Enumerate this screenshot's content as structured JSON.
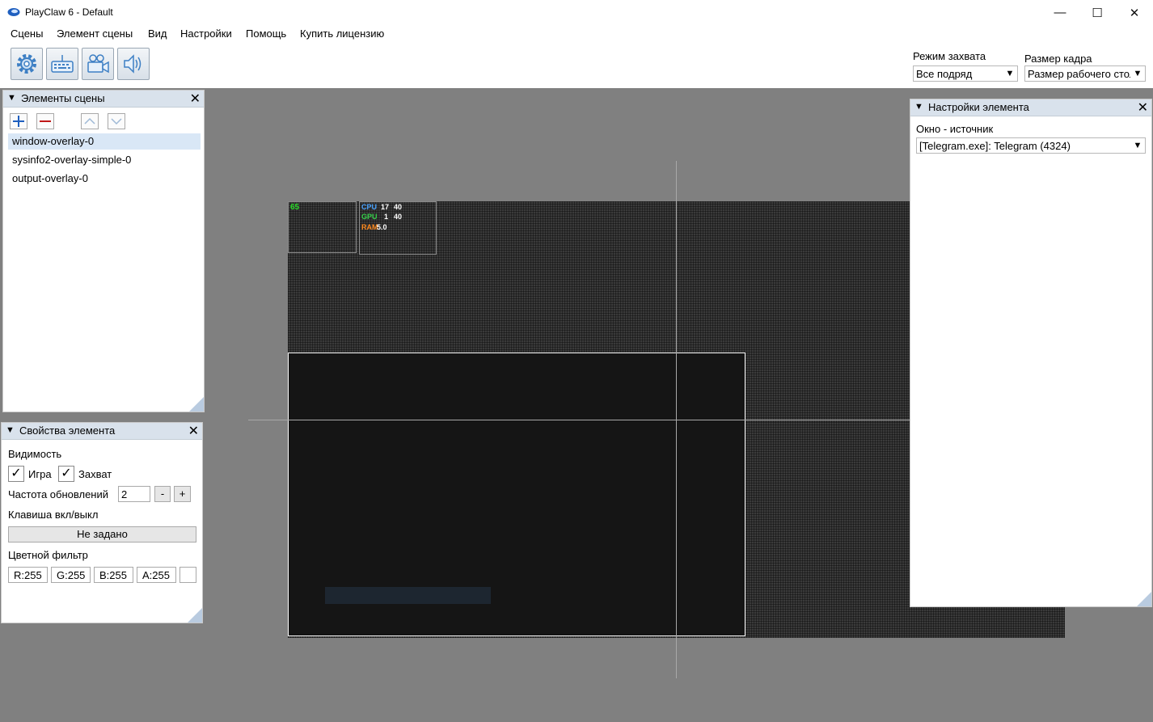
{
  "window": {
    "title": "PlayClaw 6 - Default",
    "controls": {
      "minimize": "—",
      "maximize": "☐",
      "close": "✕"
    }
  },
  "menu": [
    "Сцены",
    "Элемент сцены",
    "Вид",
    "Настройки",
    "Помощь",
    "Купить лицензию"
  ],
  "toolbar": {
    "icons": [
      "gear-icon",
      "keyboard-icon",
      "camera-icon",
      "speaker-icon"
    ],
    "capture_mode": {
      "label": "Режим захвата",
      "value": "Все подряд"
    },
    "frame_size": {
      "label": "Размер кадра",
      "value": "Размер рабочего стола"
    }
  },
  "scene_panel": {
    "title": "Элементы сцены",
    "items": [
      "window-overlay-0",
      "sysinfo2-overlay-simple-0",
      "output-overlay-0"
    ],
    "selected_index": 0
  },
  "props_panel": {
    "title": "Свойства элемента",
    "visibility_label": "Видимость",
    "game_label": "Игра",
    "capture_label": "Захват",
    "game_checked": true,
    "capture_checked": true,
    "refresh_label": "Частота обновлений",
    "refresh_value": "2",
    "minus": "-",
    "plus": "+",
    "hotkey_label": "Клавиша вкл/выкл",
    "hotkey_value": "Не задано",
    "color_filter_label": "Цветной фильтр",
    "r": "R:255",
    "g": "G:255",
    "b": "B:255",
    "a": "A:255"
  },
  "settings_panel": {
    "title": "Настройки элемента",
    "source_label": "Окно - источник",
    "source_value": "[Telegram.exe]: Telegram (4324)"
  },
  "overlay": {
    "fps": "65",
    "cpu_label": "CPU",
    "cpu_load": "17",
    "cpu_temp": "40",
    "gpu_label": "GPU",
    "gpu_load": "1",
    "gpu_temp": "40",
    "ram_label": "RAM",
    "ram_value": "5.0",
    "cpu_color": "#4aa3ff",
    "gpu_color": "#35d04a",
    "ram_color": "#ff8a1e",
    "fps_color": "#2bdc2b"
  }
}
